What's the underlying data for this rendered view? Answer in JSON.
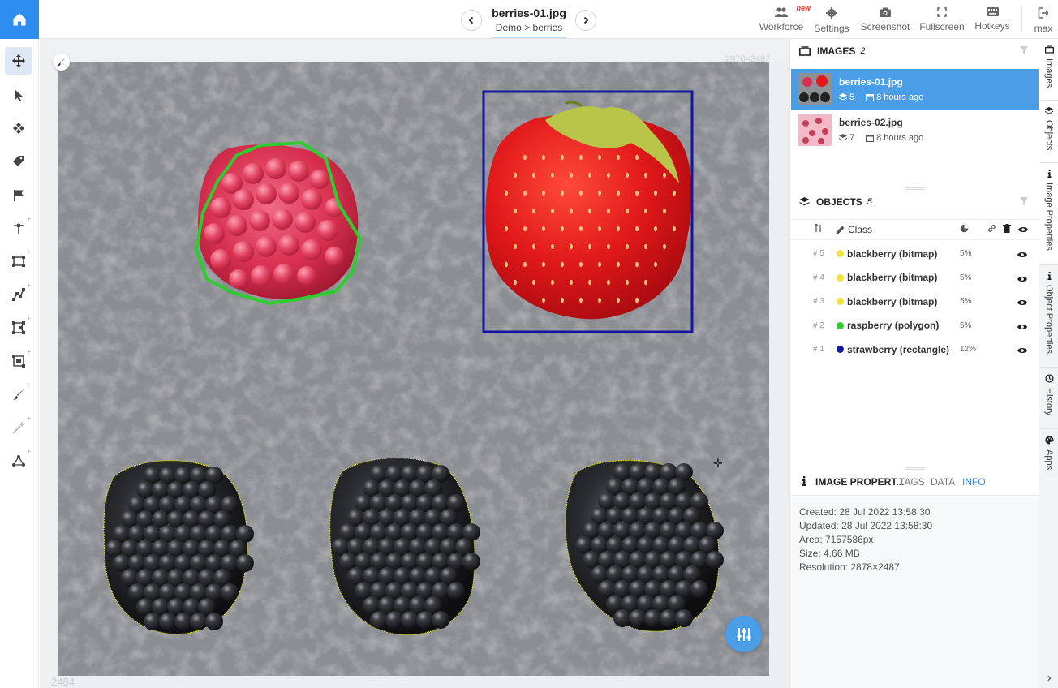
{
  "header": {
    "file_title": "berries-01.jpg",
    "breadcrumb": {
      "project": "Demo",
      "separator": ">",
      "dataset": "berries"
    },
    "actions": [
      {
        "label": "Workforce",
        "badge": "new",
        "icon": "people-icon"
      },
      {
        "label": "Settings",
        "icon": "gear-icon"
      },
      {
        "label": "Screenshot",
        "icon": "camera-icon"
      },
      {
        "label": "Fullscreen",
        "icon": "fullscreen-icon"
      },
      {
        "label": "Hotkeys",
        "icon": "keyboard-icon"
      },
      {
        "label": "max",
        "icon": "logout-icon"
      }
    ]
  },
  "toolbar": {
    "tools": [
      "move-icon",
      "pointer-icon",
      "drag-icon",
      "tag-icon",
      "flag-icon",
      "point-icon",
      "rectangle-icon",
      "polyline-icon",
      "polygon-icon",
      "bitmap-icon",
      "brush-icon",
      "magic-wand-icon",
      "graph-icon"
    ],
    "active_tool": "move-icon"
  },
  "canvas": {
    "resolution_label": "2878×2487",
    "ruler_bottom_label": "2484",
    "annotation_colors": {
      "raspberry": "#2ecc2e",
      "strawberry": "#1515a0",
      "blackberry": "#e6e617"
    }
  },
  "images_panel": {
    "title": "IMAGES",
    "count": "2",
    "items": [
      {
        "name": "berries-01.jpg",
        "objects": "5",
        "time": "8 hours ago",
        "selected": true
      },
      {
        "name": "berries-02.jpg",
        "objects": "7",
        "time": "8 hours ago",
        "selected": false
      }
    ]
  },
  "objects_panel": {
    "title": "OBJECTS",
    "count": "5",
    "class_header": "Class",
    "items": [
      {
        "id": "5",
        "name": "blackberry (bitmap)",
        "area": "5%",
        "color": "#f2e23a"
      },
      {
        "id": "4",
        "name": "blackberry (bitmap)",
        "area": "5%",
        "color": "#f2e23a"
      },
      {
        "id": "3",
        "name": "blackberry (bitmap)",
        "area": "5%",
        "color": "#f2e23a"
      },
      {
        "id": "2",
        "name": "raspberry (polygon)",
        "area": "5%",
        "color": "#2ecc2e"
      },
      {
        "id": "1",
        "name": "strawberry (rectangle)",
        "area": "12%",
        "color": "#1a1aa0"
      }
    ]
  },
  "properties_panel": {
    "title": "IMAGE PROPERT...",
    "tabs": [
      "TAGS",
      "DATA",
      "INFO"
    ],
    "active_tab": "INFO",
    "info": [
      "Created: 28 Jul 2022 13:58:30",
      "Updated: 28 Jul 2022 13:58:30",
      "Area: 7157586px",
      "Size: 4.66 MB",
      "Resolution: 2878×2487"
    ]
  },
  "side_tabs": [
    "Images",
    "Objects",
    "Image Properties",
    "Object Properties",
    "History",
    "Apps"
  ],
  "accent_color": "#2d8cf0"
}
